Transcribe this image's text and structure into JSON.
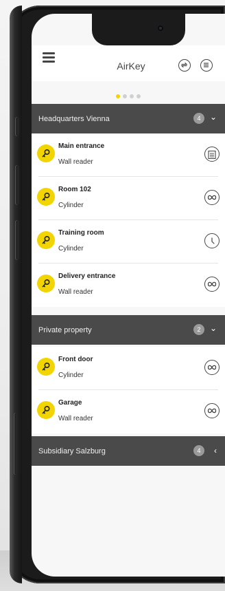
{
  "app": {
    "title": "AirKey"
  },
  "pager": {
    "count": 4,
    "active": 0
  },
  "colors": {
    "accent": "#f2d400",
    "section_bg": "#4a4a4a",
    "screen_bg": "#f7f7f7"
  },
  "sections": [
    {
      "label": "Headquarters Vienna",
      "badge": "4",
      "expanded": true,
      "items": [
        {
          "title": "Main entrance",
          "subtitle": "Wall reader",
          "status_icon": "calendar-icon"
        },
        {
          "title": "Room 102",
          "subtitle": "Cylinder",
          "status_icon": "infinity-icon"
        },
        {
          "title": "Training room",
          "subtitle": "Cylinder",
          "status_icon": "clock-icon"
        },
        {
          "title": "Delivery entrance",
          "subtitle": "Wall reader",
          "status_icon": "infinity-icon"
        }
      ]
    },
    {
      "label": "Private property",
      "badge": "2",
      "expanded": true,
      "items": [
        {
          "title": "Front door",
          "subtitle": "Cylinder",
          "status_icon": "infinity-icon"
        },
        {
          "title": "Garage",
          "subtitle": "Wall reader",
          "status_icon": "infinity-icon"
        }
      ]
    },
    {
      "label": "Subsidiary Salzburg",
      "badge": "4",
      "expanded": false,
      "items": []
    }
  ]
}
